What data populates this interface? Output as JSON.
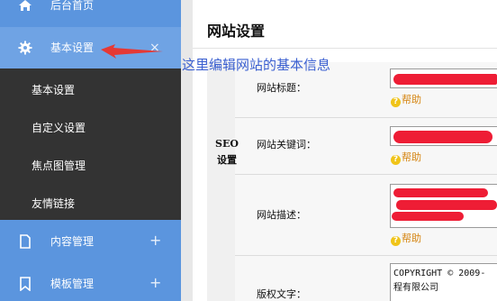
{
  "sidebar": {
    "home": {
      "label": "后台首页",
      "icon": "home-icon"
    },
    "basic": {
      "label": "基本设置",
      "icon": "gear-icon",
      "toggle": "×"
    },
    "submenu": [
      {
        "label": "基本设置"
      },
      {
        "label": "自定义设置"
      },
      {
        "label": "焦点图管理"
      },
      {
        "label": "友情链接"
      }
    ],
    "content": {
      "label": "内容管理",
      "icon": "document-icon",
      "toggle": "+"
    },
    "template": {
      "label": "模板管理",
      "icon": "bookmark-icon",
      "toggle": "+"
    }
  },
  "main": {
    "title": "网站设置",
    "section_label": "SEO设置",
    "fields": {
      "site_title": {
        "label": "网站标题：",
        "help": "帮助"
      },
      "keywords": {
        "label": "网站关键词：",
        "help": "帮助"
      },
      "description": {
        "label": "网站描述：",
        "help": "帮助"
      },
      "copyright": {
        "label": "版权文字：",
        "value_line1": "COPYRIGHT © 2009-",
        "value_line2": "程有限公司"
      }
    }
  },
  "annotation": {
    "text": "这里编辑网站的基本信息"
  },
  "colors": {
    "sidebar": "#5b95de",
    "submenu": "#333333",
    "annotation": "#3a5fd0",
    "redaction": "#ee1d35",
    "help": "#d58512"
  }
}
